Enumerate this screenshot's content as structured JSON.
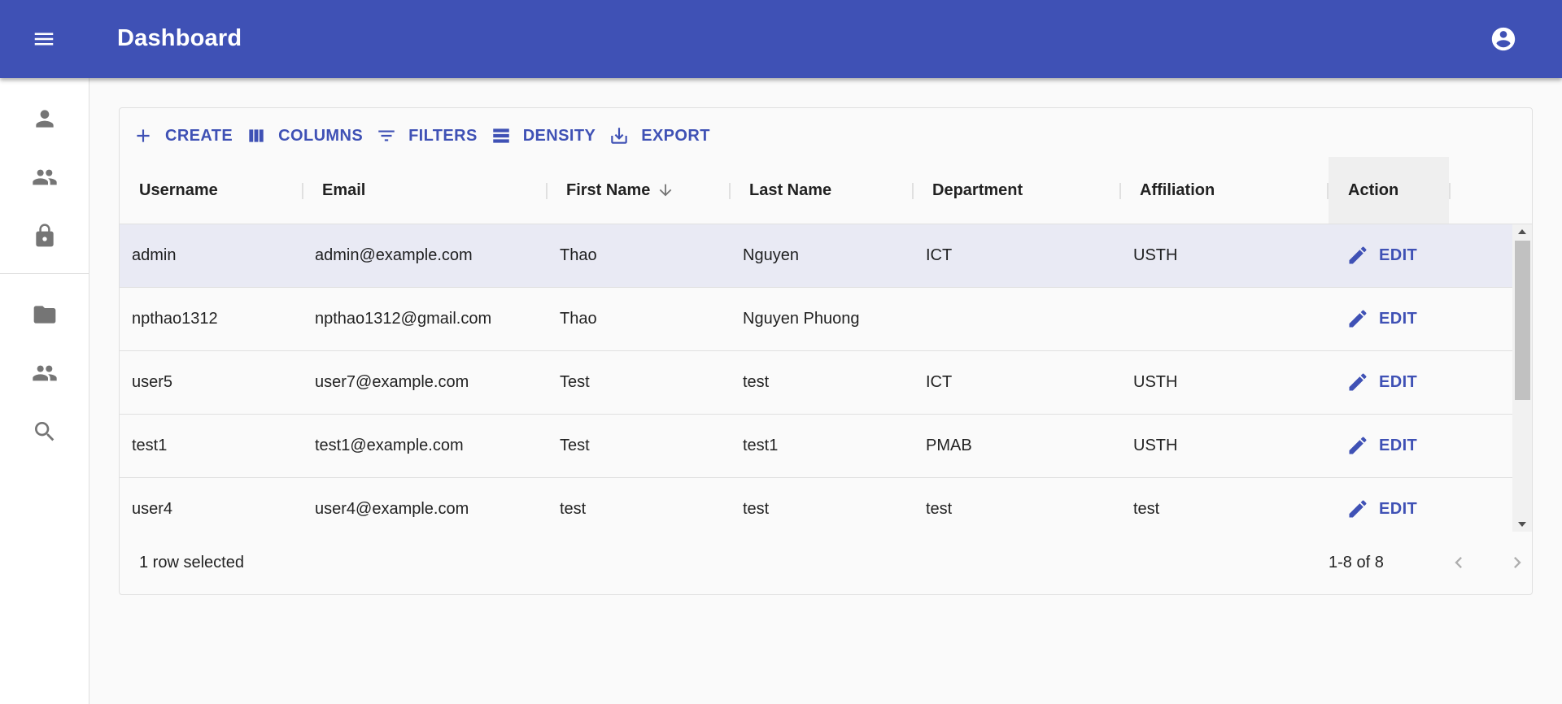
{
  "app": {
    "title": "Dashboard"
  },
  "drawer": {
    "items": [
      {
        "icon": "person-icon"
      },
      {
        "icon": "group-icon"
      },
      {
        "icon": "lock-icon"
      },
      {
        "icon": "folder-icon"
      },
      {
        "icon": "group-icon"
      },
      {
        "icon": "search-icon"
      }
    ]
  },
  "toolbar": {
    "create": "CREATE",
    "columns": "COLUMNS",
    "filters": "FILTERS",
    "density": "DENSITY",
    "export": "EXPORT"
  },
  "table": {
    "columns": [
      "Username",
      "Email",
      "First Name",
      "Last Name",
      "Department",
      "Affiliation",
      "Action"
    ],
    "sort": {
      "column": "First Name",
      "direction": "descending"
    },
    "edit_label": "EDIT",
    "rows": [
      {
        "username": "admin",
        "email": "admin@example.com",
        "first_name": "Thao",
        "last_name": "Nguyen",
        "department": "ICT",
        "affiliation": "USTH",
        "selected": true
      },
      {
        "username": "npthao1312",
        "email": "npthao1312@gmail.com",
        "first_name": "Thao",
        "last_name": "Nguyen Phuong",
        "department": "",
        "affiliation": "",
        "selected": false
      },
      {
        "username": "user5",
        "email": "user7@example.com",
        "first_name": "Test",
        "last_name": "test",
        "department": "ICT",
        "affiliation": "USTH",
        "selected": false
      },
      {
        "username": "test1",
        "email": "test1@example.com",
        "first_name": "Test",
        "last_name": "test1",
        "department": "PMAB",
        "affiliation": "USTH",
        "selected": false
      },
      {
        "username": "user4",
        "email": "user4@example.com",
        "first_name": "test",
        "last_name": "test",
        "department": "test",
        "affiliation": "test",
        "selected": false
      }
    ]
  },
  "footer": {
    "selected_text": "1 row selected",
    "pagination": "1-8 of 8"
  },
  "colors": {
    "primary": "#3f51b5",
    "selected_row": "#e9eaf4"
  }
}
